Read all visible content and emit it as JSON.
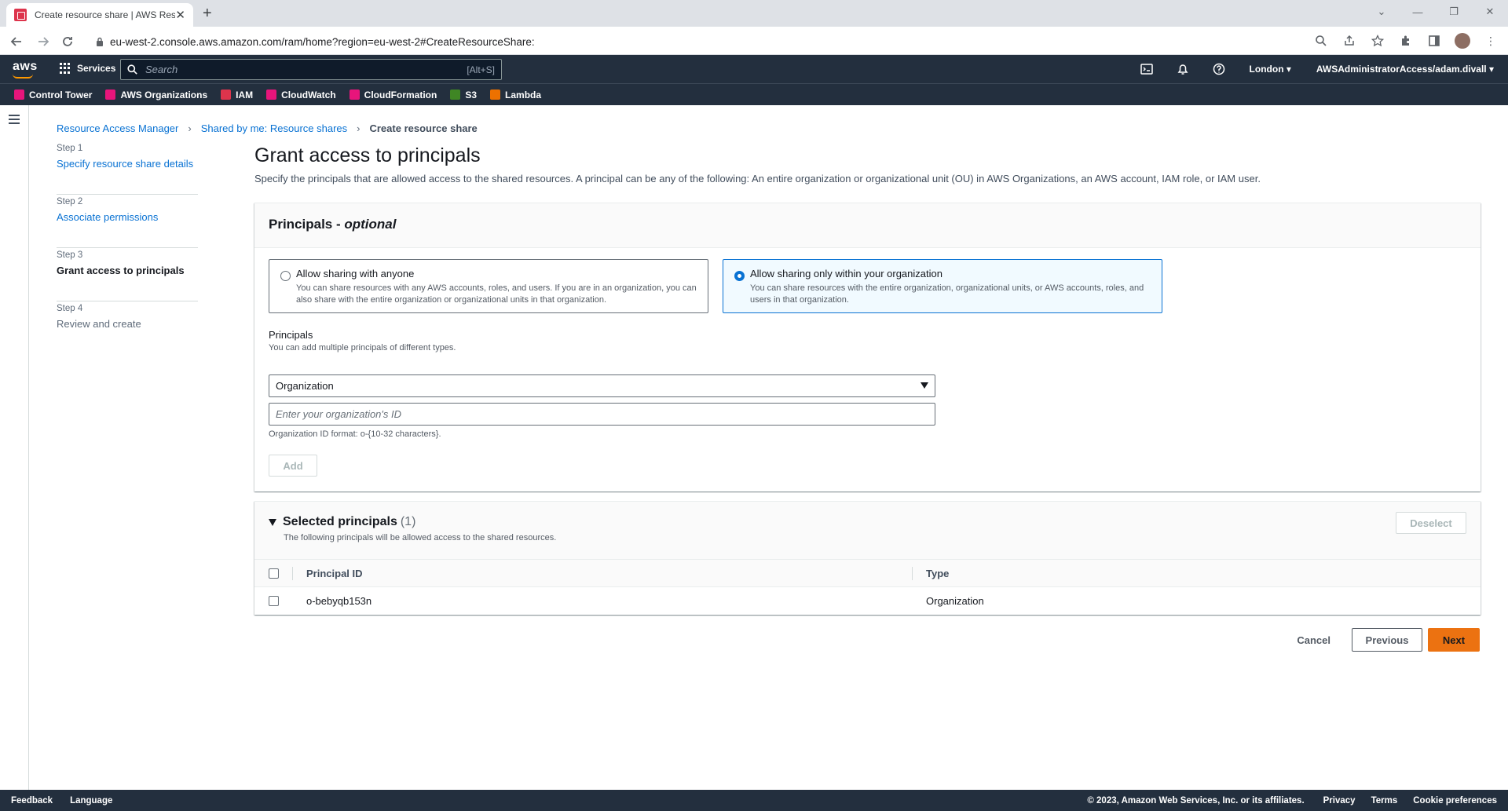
{
  "browser": {
    "tab_title": "Create resource share | AWS Resource Access Manager",
    "url": "eu-west-2.console.aws.amazon.com/ram/home?region=eu-west-2#CreateResourceShare:"
  },
  "awsnav": {
    "services_label": "Services",
    "search_placeholder": "Search",
    "search_shortcut": "[Alt+S]",
    "region": "London ▾",
    "account": "AWSAdministratorAccess/adam.divall ▾"
  },
  "favorites": [
    {
      "label": "Control Tower",
      "color": "#e7157b"
    },
    {
      "label": "AWS Organizations",
      "color": "#e7157b"
    },
    {
      "label": "IAM",
      "color": "#dd344c"
    },
    {
      "label": "CloudWatch",
      "color": "#e7157b"
    },
    {
      "label": "CloudFormation",
      "color": "#e7157b"
    },
    {
      "label": "S3",
      "color": "#3f8624"
    },
    {
      "label": "Lambda",
      "color": "#ed7100"
    }
  ],
  "breadcrumb": {
    "item1": "Resource Access Manager",
    "item2": "Shared by me: Resource shares",
    "current": "Create resource share"
  },
  "steps": [
    {
      "label": "Step 1",
      "title": "Specify resource share details"
    },
    {
      "label": "Step 2",
      "title": "Associate permissions"
    },
    {
      "label": "Step 3",
      "title": "Grant access to principals"
    },
    {
      "label": "Step 4",
      "title": "Review and create"
    }
  ],
  "page": {
    "title": "Grant access to principals",
    "description": "Specify the principals that are allowed access to the shared resources. A principal can be any of the following: An entire organization or organizational unit (OU) in AWS Organizations, an AWS account, IAM role, or IAM user."
  },
  "principals_card": {
    "header": "Principals - ",
    "header_optional": "optional",
    "option_anyone": {
      "title": "Allow sharing with anyone",
      "desc": "You can share resources with any AWS accounts, roles, and users. If you are in an organization, you can also share with the entire organization or organizational units in that organization."
    },
    "option_org": {
      "title": "Allow sharing only within your organization",
      "desc": "You can share resources with the entire organization, organizational units, or AWS accounts, roles, and users in that organization."
    },
    "principals_label": "Principals",
    "principals_hint": "You can add multiple principals of different types.",
    "principal_type": "Organization",
    "org_id_placeholder": "Enter your organization's ID",
    "org_id_hint": "Organization ID format: o-{10-32 characters}.",
    "add_label": "Add"
  },
  "selected_card": {
    "title": "Selected principals",
    "count": "(1)",
    "description": "The following principals will be allowed access to the shared resources.",
    "deselect_label": "Deselect",
    "col_id": "Principal ID",
    "col_type": "Type",
    "rows": [
      {
        "id": "o-bebyqb153n",
        "type": "Organization"
      }
    ]
  },
  "actions": {
    "cancel": "Cancel",
    "previous": "Previous",
    "next": "Next"
  },
  "footer": {
    "feedback": "Feedback",
    "language": "Language",
    "copyright": "© 2023, Amazon Web Services, Inc. or its affiliates.",
    "privacy": "Privacy",
    "terms": "Terms",
    "cookies": "Cookie preferences"
  }
}
